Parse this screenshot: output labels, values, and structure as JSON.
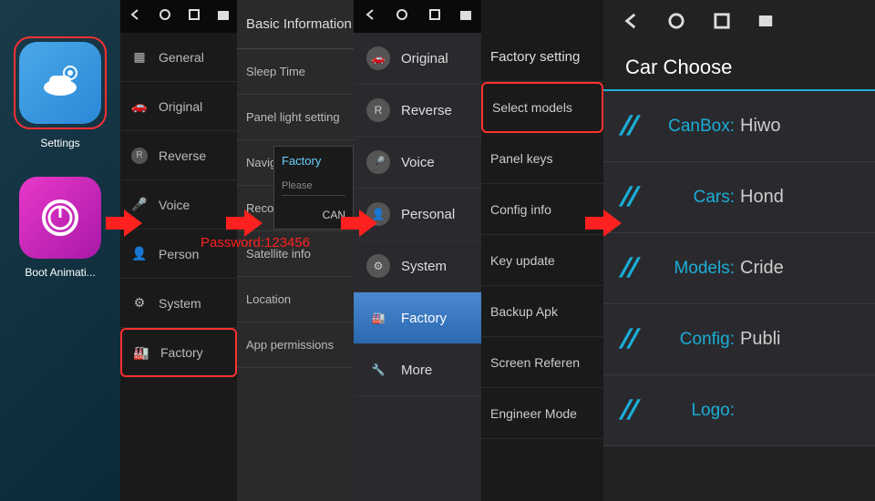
{
  "home": {
    "apps": [
      {
        "label": "Settings"
      },
      {
        "label": "Boot Animati..."
      }
    ]
  },
  "settings_menu": {
    "items": [
      {
        "label": "General"
      },
      {
        "label": "Original"
      },
      {
        "label": "Reverse"
      },
      {
        "label": "Voice"
      },
      {
        "label": "Person"
      },
      {
        "label": "System"
      },
      {
        "label": "Factory"
      }
    ]
  },
  "basic_info": {
    "header": "Basic Information",
    "rows": [
      "Sleep Time",
      "Panel light setting",
      "Navigation",
      "Record",
      "Satellite info",
      "Location",
      "App permissions"
    ],
    "dialog": {
      "title": "Factory",
      "placeholder": "Please",
      "btn": "CAN"
    },
    "password_text": "Password:123456"
  },
  "menu2": {
    "items": [
      {
        "label": "Original"
      },
      {
        "label": "Reverse"
      },
      {
        "label": "Voice"
      },
      {
        "label": "Personal"
      },
      {
        "label": "System"
      },
      {
        "label": "Factory"
      },
      {
        "label": "More"
      }
    ]
  },
  "factory_settings": {
    "header": "Factory setting",
    "rows": [
      "Select models",
      "Panel keys",
      "Config info",
      "Key update",
      "Backup Apk",
      "Screen Referen",
      "Engineer Mode"
    ]
  },
  "car_choose": {
    "title": "Car Choose",
    "fields": [
      {
        "label": "CanBox:",
        "value": "Hiwo"
      },
      {
        "label": "Cars:",
        "value": "Hond"
      },
      {
        "label": "Models:",
        "value": "Cride"
      },
      {
        "label": "Config:",
        "value": "Publi"
      },
      {
        "label": "Logo:",
        "value": ""
      }
    ]
  }
}
